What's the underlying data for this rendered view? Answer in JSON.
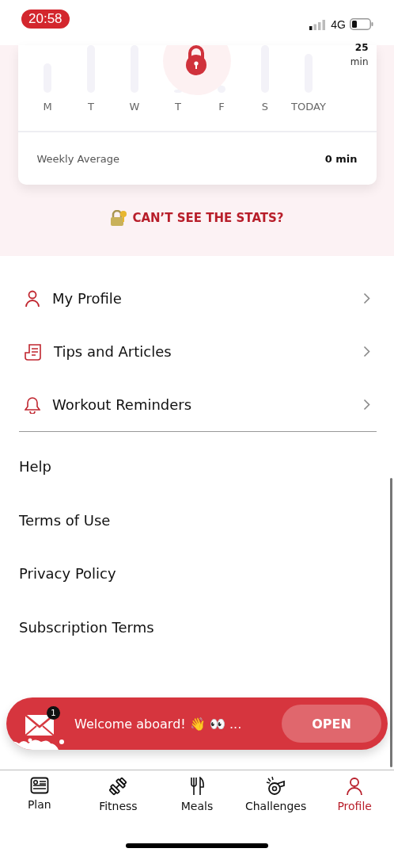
{
  "status_bar": {
    "time": "20:58",
    "network": "4G"
  },
  "stats_card": {
    "goal_value": "25",
    "goal_unit": "min",
    "days": [
      {
        "label": "M"
      },
      {
        "label": "T"
      },
      {
        "label": "W"
      },
      {
        "label": "T"
      },
      {
        "label": "F"
      },
      {
        "label": "S"
      },
      {
        "label": "TODAY"
      }
    ],
    "locked": true,
    "summary_label": "Weekly Average",
    "summary_value": "0 min"
  },
  "unlock_link": "CAN’T SEE THE STATS?",
  "menu_items": [
    {
      "kind": "profile",
      "label": "My Profile"
    },
    {
      "kind": "articles",
      "label": "Tips and Articles"
    },
    {
      "kind": "reminders",
      "label": "Workout Reminders"
    }
  ],
  "links": [
    "Help",
    "Terms of Use",
    "Privacy Policy",
    "Subscription Terms"
  ],
  "message_banner": {
    "badge": "1",
    "text": "Welcome aboard! 👋 👀 ...",
    "button": "OPEN"
  },
  "tabs": [
    {
      "kind": "plan",
      "label": "Plan",
      "selected": false
    },
    {
      "kind": "fitness",
      "label": "Fitness",
      "selected": false
    },
    {
      "kind": "meals",
      "label": "Meals",
      "selected": false
    },
    {
      "kind": "challenges",
      "label": "Challenges",
      "selected": false
    },
    {
      "kind": "profile",
      "label": "Profile",
      "selected": true
    }
  ]
}
